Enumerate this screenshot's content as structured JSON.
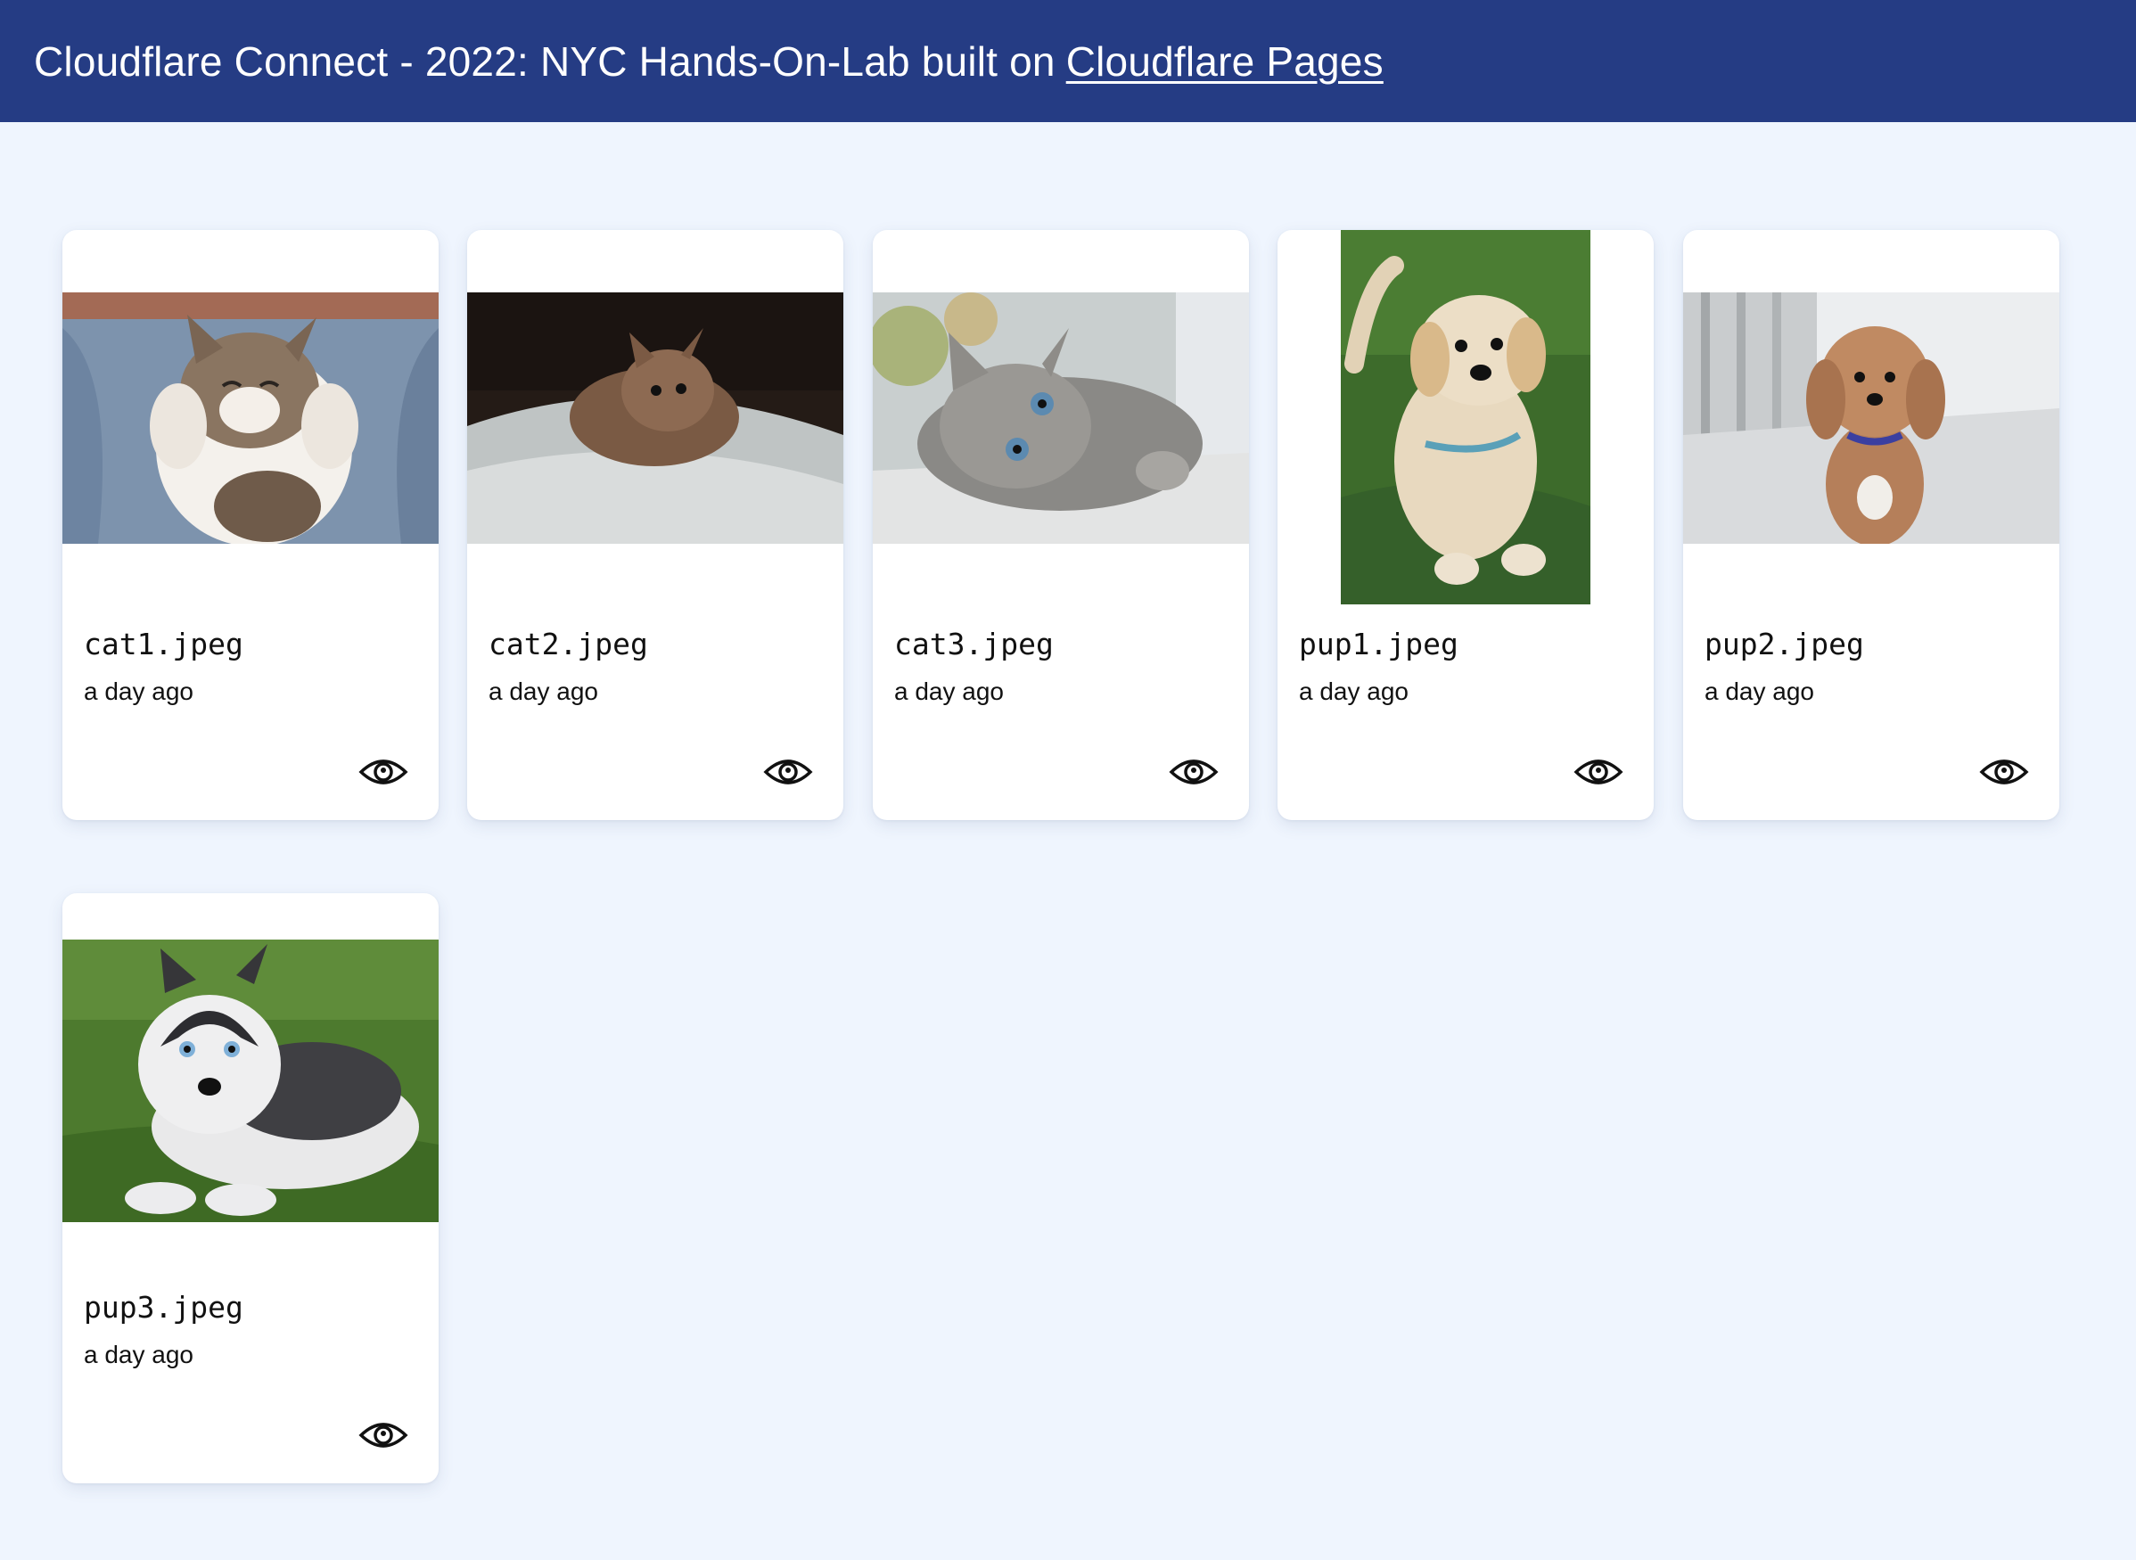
{
  "header": {
    "title_prefix": "Cloudflare Connect - 2022: NYC Hands-On-Lab built on",
    "link_label": "Cloudflare Pages",
    "background": "#253c84"
  },
  "page": {
    "background": "#eff5fe"
  },
  "files": [
    {
      "name": "cat1.jpeg",
      "uploaded": "a day ago",
      "thumbnail": "tabby-kitten-on-lap",
      "action_icon": "eye-icon"
    },
    {
      "name": "cat2.jpeg",
      "uploaded": "a day ago",
      "thumbnail": "fluffy-kitten-on-blanket",
      "action_icon": "eye-icon"
    },
    {
      "name": "cat3.jpeg",
      "uploaded": "a day ago",
      "thumbnail": "grey-kitten-lying",
      "action_icon": "eye-icon"
    },
    {
      "name": "pup1.jpeg",
      "uploaded": "a day ago",
      "thumbnail": "golden-puppy-on-grass",
      "action_icon": "eye-icon"
    },
    {
      "name": "pup2.jpeg",
      "uploaded": "a day ago",
      "thumbnail": "curly-dog-on-porch",
      "action_icon": "eye-icon"
    },
    {
      "name": "pup3.jpeg",
      "uploaded": "a day ago",
      "thumbnail": "husky-puppy-on-grass",
      "action_icon": "eye-icon"
    }
  ]
}
